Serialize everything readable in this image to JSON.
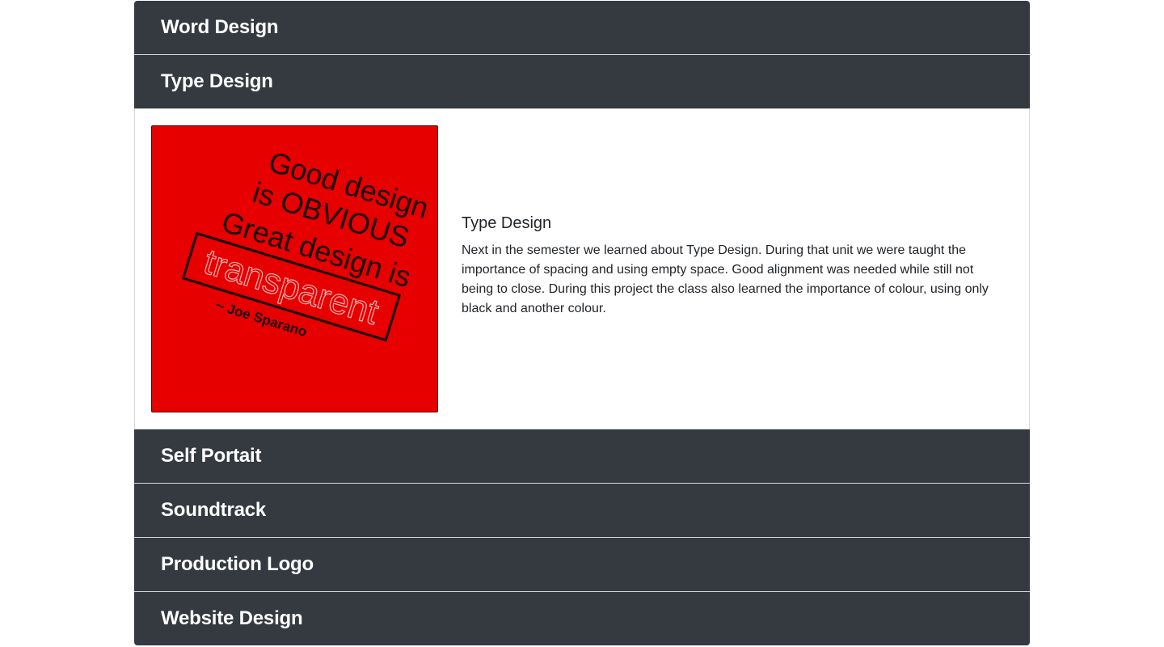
{
  "accordion": {
    "sections": [
      {
        "title": "Word Design"
      },
      {
        "title": "Type Design"
      },
      {
        "title": "Self Portait"
      },
      {
        "title": "Soundtrack"
      },
      {
        "title": "Production Logo"
      },
      {
        "title": "Website Design"
      }
    ],
    "expanded": {
      "heading": "Type Design",
      "paragraph": "Next in the semester we learned about Type Design. During that unit we were taught the importance of spacing and using empty space. Good alignment was needed while still not being to close. During this project the class also learned the importance of colour, using only black and another colour.",
      "poster": {
        "background": "#e60000",
        "line1": "Good design",
        "line2": "is OBVIOUS",
        "line3": "Great design is",
        "line4": "transparent",
        "attribution": "~ Joe Sparano"
      }
    }
  },
  "colors": {
    "header_bg": "#343a40",
    "header_text": "#ffffff",
    "body_text": "#212529",
    "poster_red": "#e60000"
  }
}
